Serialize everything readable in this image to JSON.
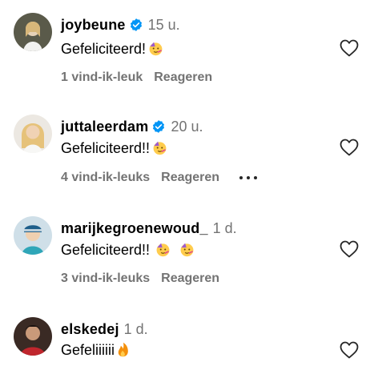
{
  "comments": [
    {
      "username": "joybeune",
      "verified": true,
      "time": "15 u.",
      "text": "Gefeliciteerd!",
      "emoji_count": 1,
      "likes": "1 vind-ik-leuk",
      "reply": "Reageren",
      "more_options": false
    },
    {
      "username": "juttaleerdam",
      "verified": true,
      "time": "20 u.",
      "text": "Gefeliciteerd!!",
      "emoji_count": 1,
      "likes": "4 vind-ik-leuks",
      "reply": "Reageren",
      "more_options": true
    },
    {
      "username": "marijkegroenewoud_",
      "verified": false,
      "time": "1 d.",
      "text": "Gefeliciteerd!!",
      "emoji_count": 2,
      "likes": "3 vind-ik-leuks",
      "reply": "Reageren",
      "more_options": false
    },
    {
      "username": "elskedej",
      "verified": false,
      "time": "1 d.",
      "text": "Gefeliiiiii",
      "emoji_count": 1,
      "likes": "",
      "reply": "",
      "more_options": false
    }
  ],
  "icons": {
    "verified": "verified-badge-icon",
    "heart": "heart-outline-icon",
    "party_emoji": "partying-face-emoji",
    "fire_emoji": "fire-emoji",
    "more": "more-options-icon"
  },
  "colors": {
    "secondary_text": "#737373",
    "verified_blue": "#0095f6"
  }
}
